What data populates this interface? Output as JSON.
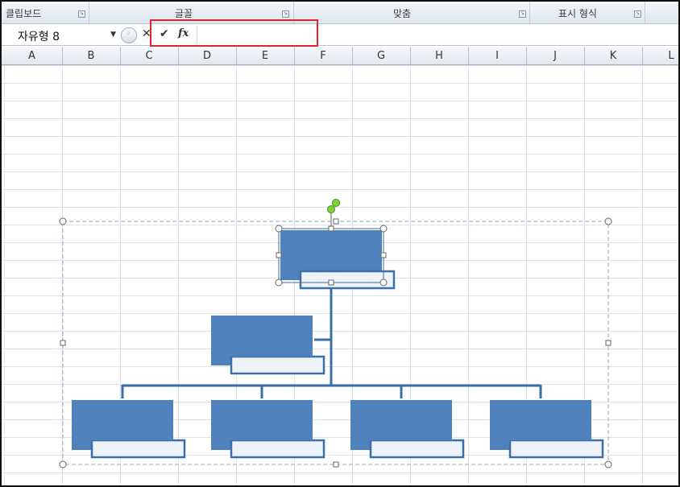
{
  "ribbon": {
    "groups": [
      {
        "label": "클립보드"
      },
      {
        "label": "글꼴"
      },
      {
        "label": "맞춤"
      },
      {
        "label": "표시 형식"
      }
    ]
  },
  "formula_bar": {
    "name_box_value": "자유형 8",
    "formula_value": "",
    "fx_label": "fx",
    "enter_glyph": "✔",
    "cancel_glyph": "✕"
  },
  "columns": [
    "A",
    "B",
    "C",
    "D",
    "E",
    "F",
    "G",
    "H",
    "I",
    "J",
    "K",
    "L"
  ],
  "colors": {
    "shape_fill": "#4f81bd",
    "shape_border": "#3c6ea8",
    "selection_handle_green": "#7fd43b",
    "highlight_red": "#e0262b"
  }
}
